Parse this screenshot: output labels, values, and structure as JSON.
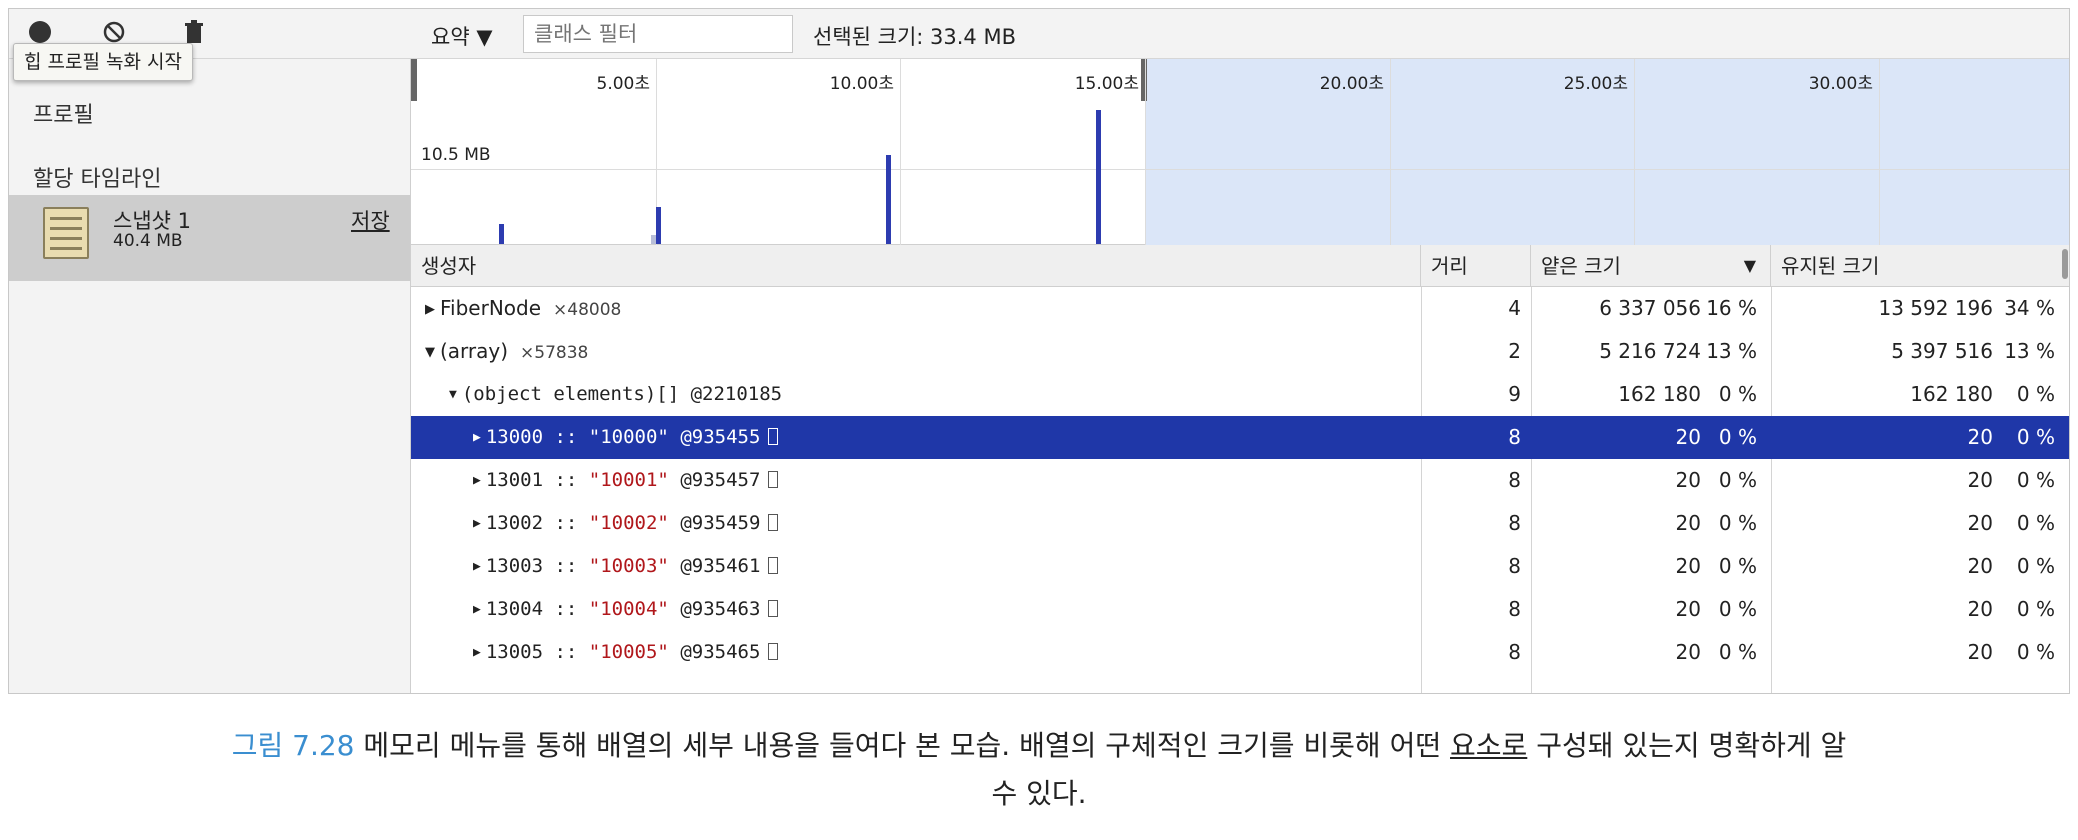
{
  "sidebar": {
    "tooltip": "힙 프로필 녹화 시작",
    "profiles_heading": "프로필",
    "allocation_heading": "할당 타임라인",
    "snapshot": {
      "name": "스냅샷 1",
      "size": "40.4 MB",
      "save_label": "저장"
    }
  },
  "toolbar": {
    "view_select": "요약 ▼",
    "filter_placeholder": "클래스 필터",
    "selected_size": "선택된 크기: 33.4 MB"
  },
  "timeline": {
    "ticks": [
      "5.00초",
      "10.00초",
      "15.00초",
      "20.00초",
      "25.00초",
      "30.00초"
    ],
    "memory_label": "10.5 MB",
    "selection_range_seconds": [
      0,
      15
    ],
    "spikes": [
      {
        "t": 1.8,
        "level": 0.11,
        "grey": false
      },
      {
        "t": 4.9,
        "level": 0.05,
        "grey": true
      },
      {
        "t": 5.0,
        "level": 0.2,
        "grey": false
      },
      {
        "t": 9.7,
        "level": 0.48,
        "grey": false
      },
      {
        "t": 14.0,
        "level": 0.72,
        "grey": false
      }
    ]
  },
  "table": {
    "headers": {
      "constructor": "생성자",
      "distance": "거리",
      "shallow": "얕은 크기",
      "sort_indicator": "▼",
      "retained": "유지된 크기"
    },
    "rows": [
      {
        "indent": 0,
        "arrow": "▶",
        "name": "FiberNode",
        "count": "×48008",
        "distance": "4",
        "shallow": "6 337 056",
        "shallow_pct": "16 %",
        "retained": "13 592 196",
        "retained_pct": "34 %"
      },
      {
        "indent": 0,
        "arrow": "▼",
        "name": "(array)",
        "count": "×57838",
        "distance": "2",
        "shallow": "5 216 724",
        "shallow_pct": "13 %",
        "retained": "5 397 516",
        "retained_pct": "13 %"
      },
      {
        "indent": 1,
        "arrow": "▼",
        "name": "(object elements)[] @2210185",
        "distance": "9",
        "shallow": "162 180",
        "shallow_pct": "0 %",
        "retained": "162 180",
        "retained_pct": "0 %"
      },
      {
        "indent": 2,
        "arrow": "▶",
        "idx": "13000",
        "sep": " :: ",
        "str": "\"10000\"",
        "ref": " @935455",
        "distance": "8",
        "shallow": "20",
        "shallow_pct": "0 %",
        "retained": "20",
        "retained_pct": "0 %",
        "selected": true
      },
      {
        "indent": 2,
        "arrow": "▶",
        "idx": "13001",
        "sep": " :: ",
        "str": "\"10001\"",
        "ref": " @935457",
        "distance": "8",
        "shallow": "20",
        "shallow_pct": "0 %",
        "retained": "20",
        "retained_pct": "0 %"
      },
      {
        "indent": 2,
        "arrow": "▶",
        "idx": "13002",
        "sep": " :: ",
        "str": "\"10002\"",
        "ref": " @935459",
        "distance": "8",
        "shallow": "20",
        "shallow_pct": "0 %",
        "retained": "20",
        "retained_pct": "0 %"
      },
      {
        "indent": 2,
        "arrow": "▶",
        "idx": "13003",
        "sep": " :: ",
        "str": "\"10003\"",
        "ref": " @935461",
        "distance": "8",
        "shallow": "20",
        "shallow_pct": "0 %",
        "retained": "20",
        "retained_pct": "0 %"
      },
      {
        "indent": 2,
        "arrow": "▶",
        "idx": "13004",
        "sep": " :: ",
        "str": "\"10004\"",
        "ref": " @935463",
        "distance": "8",
        "shallow": "20",
        "shallow_pct": "0 %",
        "retained": "20",
        "retained_pct": "0 %"
      },
      {
        "indent": 2,
        "arrow": "▶",
        "idx": "13005",
        "sep": " :: ",
        "str": "\"10005\"",
        "ref": " @935465",
        "distance": "8",
        "shallow": "20",
        "shallow_pct": "0 %",
        "retained": "20",
        "retained_pct": "0 %"
      }
    ]
  },
  "caption": {
    "label": "그림 7.28",
    "text_before": " 메모리 메뉴를 통해 배열의 세부 내용을 들여다 본 모습. 배열의 구체적인 크기를 비롯해 어떤 ",
    "link": "요소로",
    "text_after": " 구성돼 있는지 명확하게 알",
    "line2": "수 있다."
  },
  "colors": {
    "selection": "#1f37a8",
    "string": "#b0171b",
    "caption_label": "#3a8ed0",
    "timeline_shade": "#dbe6f8",
    "bar": "#2d3cb0"
  },
  "icons": [
    "record-icon",
    "clear-icon",
    "trash-icon",
    "snapshot-icon",
    "expand-arrow-icon",
    "collapse-arrow-icon"
  ]
}
